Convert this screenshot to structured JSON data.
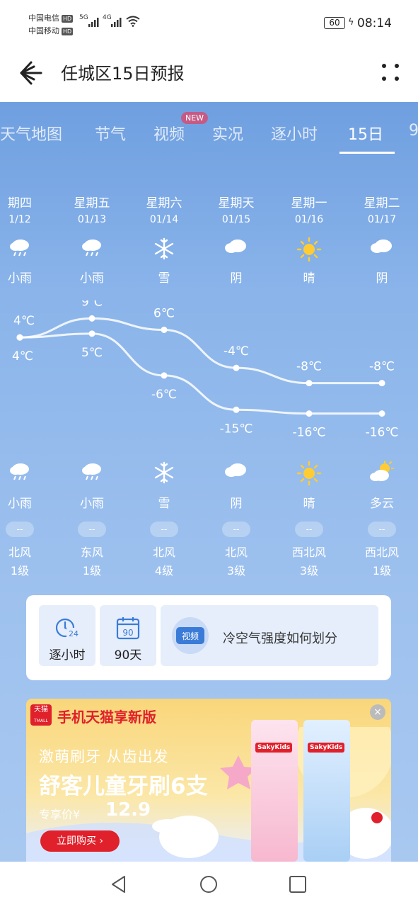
{
  "status_bar": {
    "carrier1": "中国电信",
    "carrier2": "中国移动",
    "hd": "HD",
    "net1": "5G",
    "net2": "4G",
    "battery": "60",
    "time": "08:14"
  },
  "header": {
    "title": "任城区15日预报"
  },
  "tabs": [
    {
      "label": "天气地图"
    },
    {
      "label": "节气"
    },
    {
      "label": "视频",
      "badge": "NEW"
    },
    {
      "label": "实况"
    },
    {
      "label": "逐小时"
    },
    {
      "label": "15日",
      "active": true
    },
    {
      "label": "9"
    }
  ],
  "days": [
    {
      "weekday": "期四",
      "date": "1/12",
      "day_cond": "小雨",
      "day_icon": "light-rain-icon",
      "high": "4℃",
      "low": "4℃",
      "night_cond": "小雨",
      "night_icon": "light-rain-icon",
      "wind_level": "--",
      "wind_dir": "北风",
      "wind_scale": "1级"
    },
    {
      "weekday": "星期五",
      "date": "01/13",
      "day_cond": "小雨",
      "day_icon": "light-rain-icon",
      "high": "9℃",
      "low": "5℃",
      "night_cond": "小雨",
      "night_icon": "light-rain-icon",
      "wind_level": "--",
      "wind_dir": "东风",
      "wind_scale": "1级"
    },
    {
      "weekday": "星期六",
      "date": "01/14",
      "day_cond": "雪",
      "day_icon": "snow-icon",
      "high": "6℃",
      "low": "-6℃",
      "night_cond": "雪",
      "night_icon": "snow-icon",
      "wind_level": "--",
      "wind_dir": "北风",
      "wind_scale": "4级"
    },
    {
      "weekday": "星期天",
      "date": "01/15",
      "day_cond": "阴",
      "day_icon": "cloudy-icon",
      "high": "-4℃",
      "low": "-15℃",
      "night_cond": "阴",
      "night_icon": "cloudy-icon",
      "wind_level": "--",
      "wind_dir": "北风",
      "wind_scale": "3级"
    },
    {
      "weekday": "星期一",
      "date": "01/16",
      "day_cond": "晴",
      "day_icon": "sunny-icon",
      "high": "-8℃",
      "low": "-16℃",
      "night_cond": "晴",
      "night_icon": "sunny-icon",
      "wind_level": "--",
      "wind_dir": "西北风",
      "wind_scale": "3级"
    },
    {
      "weekday": "星期二",
      "date": "01/17",
      "day_cond": "阴",
      "day_icon": "cloudy-icon",
      "high": "-8℃",
      "low": "-16℃",
      "night_cond": "多云",
      "night_icon": "partly-cloudy-icon",
      "wind_level": "--",
      "wind_dir": "西北风",
      "wind_scale": "1级"
    }
  ],
  "quick_links": {
    "hourly": "逐小时",
    "hourly_icon_num": "24",
    "days90": "90天",
    "days90_icon_num": "90",
    "video_tag": "视频",
    "video_title": "冷空气强度如何划分"
  },
  "ad": {
    "logo": "天猫",
    "logo_sub": "TMALL",
    "brand_line": "手机天猫享新版",
    "sub": "激萌刷牙 从齿出发",
    "headline": "舒客儿童牙刷6支",
    "price_label": "专享价¥",
    "price": "12.9",
    "cta": "立即购买",
    "close": "×",
    "product_brand": "SakyKids"
  },
  "colors": {
    "accent_red": "#e0202b",
    "new_badge": "#c45b86",
    "bg_blue": "#7aa6e0"
  }
}
